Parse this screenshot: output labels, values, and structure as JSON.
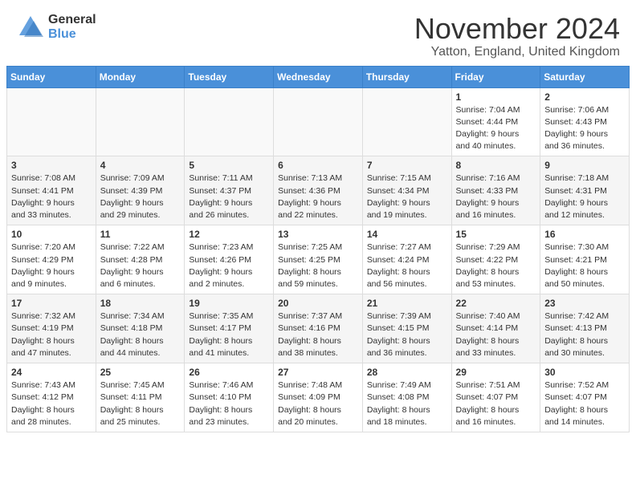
{
  "logo": {
    "general": "General",
    "blue": "Blue"
  },
  "header": {
    "month": "November 2024",
    "location": "Yatton, England, United Kingdom"
  },
  "weekdays": [
    "Sunday",
    "Monday",
    "Tuesday",
    "Wednesday",
    "Thursday",
    "Friday",
    "Saturday"
  ],
  "weeks": [
    [
      {
        "day": "",
        "info": ""
      },
      {
        "day": "",
        "info": ""
      },
      {
        "day": "",
        "info": ""
      },
      {
        "day": "",
        "info": ""
      },
      {
        "day": "",
        "info": ""
      },
      {
        "day": "1",
        "info": "Sunrise: 7:04 AM\nSunset: 4:44 PM\nDaylight: 9 hours\nand 40 minutes."
      },
      {
        "day": "2",
        "info": "Sunrise: 7:06 AM\nSunset: 4:43 PM\nDaylight: 9 hours\nand 36 minutes."
      }
    ],
    [
      {
        "day": "3",
        "info": "Sunrise: 7:08 AM\nSunset: 4:41 PM\nDaylight: 9 hours\nand 33 minutes."
      },
      {
        "day": "4",
        "info": "Sunrise: 7:09 AM\nSunset: 4:39 PM\nDaylight: 9 hours\nand 29 minutes."
      },
      {
        "day": "5",
        "info": "Sunrise: 7:11 AM\nSunset: 4:37 PM\nDaylight: 9 hours\nand 26 minutes."
      },
      {
        "day": "6",
        "info": "Sunrise: 7:13 AM\nSunset: 4:36 PM\nDaylight: 9 hours\nand 22 minutes."
      },
      {
        "day": "7",
        "info": "Sunrise: 7:15 AM\nSunset: 4:34 PM\nDaylight: 9 hours\nand 19 minutes."
      },
      {
        "day": "8",
        "info": "Sunrise: 7:16 AM\nSunset: 4:33 PM\nDaylight: 9 hours\nand 16 minutes."
      },
      {
        "day": "9",
        "info": "Sunrise: 7:18 AM\nSunset: 4:31 PM\nDaylight: 9 hours\nand 12 minutes."
      }
    ],
    [
      {
        "day": "10",
        "info": "Sunrise: 7:20 AM\nSunset: 4:29 PM\nDaylight: 9 hours\nand 9 minutes."
      },
      {
        "day": "11",
        "info": "Sunrise: 7:22 AM\nSunset: 4:28 PM\nDaylight: 9 hours\nand 6 minutes."
      },
      {
        "day": "12",
        "info": "Sunrise: 7:23 AM\nSunset: 4:26 PM\nDaylight: 9 hours\nand 2 minutes."
      },
      {
        "day": "13",
        "info": "Sunrise: 7:25 AM\nSunset: 4:25 PM\nDaylight: 8 hours\nand 59 minutes."
      },
      {
        "day": "14",
        "info": "Sunrise: 7:27 AM\nSunset: 4:24 PM\nDaylight: 8 hours\nand 56 minutes."
      },
      {
        "day": "15",
        "info": "Sunrise: 7:29 AM\nSunset: 4:22 PM\nDaylight: 8 hours\nand 53 minutes."
      },
      {
        "day": "16",
        "info": "Sunrise: 7:30 AM\nSunset: 4:21 PM\nDaylight: 8 hours\nand 50 minutes."
      }
    ],
    [
      {
        "day": "17",
        "info": "Sunrise: 7:32 AM\nSunset: 4:19 PM\nDaylight: 8 hours\nand 47 minutes."
      },
      {
        "day": "18",
        "info": "Sunrise: 7:34 AM\nSunset: 4:18 PM\nDaylight: 8 hours\nand 44 minutes."
      },
      {
        "day": "19",
        "info": "Sunrise: 7:35 AM\nSunset: 4:17 PM\nDaylight: 8 hours\nand 41 minutes."
      },
      {
        "day": "20",
        "info": "Sunrise: 7:37 AM\nSunset: 4:16 PM\nDaylight: 8 hours\nand 38 minutes."
      },
      {
        "day": "21",
        "info": "Sunrise: 7:39 AM\nSunset: 4:15 PM\nDaylight: 8 hours\nand 36 minutes."
      },
      {
        "day": "22",
        "info": "Sunrise: 7:40 AM\nSunset: 4:14 PM\nDaylight: 8 hours\nand 33 minutes."
      },
      {
        "day": "23",
        "info": "Sunrise: 7:42 AM\nSunset: 4:13 PM\nDaylight: 8 hours\nand 30 minutes."
      }
    ],
    [
      {
        "day": "24",
        "info": "Sunrise: 7:43 AM\nSunset: 4:12 PM\nDaylight: 8 hours\nand 28 minutes."
      },
      {
        "day": "25",
        "info": "Sunrise: 7:45 AM\nSunset: 4:11 PM\nDaylight: 8 hours\nand 25 minutes."
      },
      {
        "day": "26",
        "info": "Sunrise: 7:46 AM\nSunset: 4:10 PM\nDaylight: 8 hours\nand 23 minutes."
      },
      {
        "day": "27",
        "info": "Sunrise: 7:48 AM\nSunset: 4:09 PM\nDaylight: 8 hours\nand 20 minutes."
      },
      {
        "day": "28",
        "info": "Sunrise: 7:49 AM\nSunset: 4:08 PM\nDaylight: 8 hours\nand 18 minutes."
      },
      {
        "day": "29",
        "info": "Sunrise: 7:51 AM\nSunset: 4:07 PM\nDaylight: 8 hours\nand 16 minutes."
      },
      {
        "day": "30",
        "info": "Sunrise: 7:52 AM\nSunset: 4:07 PM\nDaylight: 8 hours\nand 14 minutes."
      }
    ]
  ]
}
